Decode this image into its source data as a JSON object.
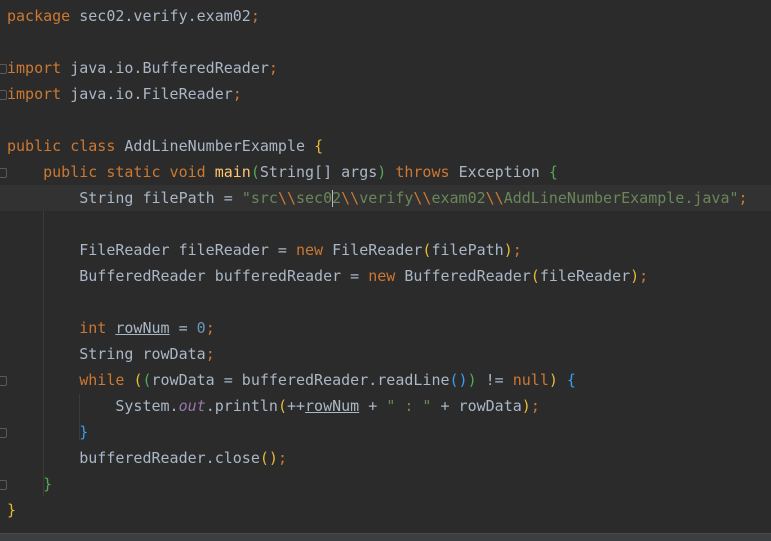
{
  "editor": {
    "lines": [
      [
        {
          "t": "package",
          "c": "kw"
        },
        {
          "t": " sec02.verify.exam02",
          "c": "plain"
        },
        {
          "t": ";",
          "c": "kw"
        }
      ],
      [],
      [
        {
          "t": "import",
          "c": "kw"
        },
        {
          "t": " java.io.BufferedReader",
          "c": "plain"
        },
        {
          "t": ";",
          "c": "kw"
        }
      ],
      [
        {
          "t": "import",
          "c": "kw"
        },
        {
          "t": " java.io.FileReader",
          "c": "plain"
        },
        {
          "t": ";",
          "c": "kw"
        }
      ],
      [],
      [
        {
          "t": "public class ",
          "c": "kw"
        },
        {
          "t": "AddLineNumberExample ",
          "c": "plain"
        },
        {
          "t": "{",
          "c": "p1"
        }
      ],
      [
        {
          "t": "    ",
          "c": "plain"
        },
        {
          "t": "public static void ",
          "c": "kw"
        },
        {
          "t": "main",
          "c": "fn"
        },
        {
          "t": "(",
          "c": "p2"
        },
        {
          "t": "String[] args",
          "c": "plain"
        },
        {
          "t": ")",
          "c": "p2"
        },
        {
          "t": " throws ",
          "c": "kw"
        },
        {
          "t": "Exception ",
          "c": "plain"
        },
        {
          "t": "{",
          "c": "p2"
        }
      ],
      [
        {
          "t": "        String filePath = ",
          "c": "plain"
        },
        {
          "t": "\"src",
          "c": "str"
        },
        {
          "t": "\\\\",
          "c": "esc"
        },
        {
          "t": "sec02",
          "c": "str"
        },
        {
          "t": "\\\\",
          "c": "esc"
        },
        {
          "t": "verify",
          "c": "str"
        },
        {
          "t": "\\\\",
          "c": "esc"
        },
        {
          "t": "exam02",
          "c": "str"
        },
        {
          "t": "\\\\",
          "c": "esc"
        },
        {
          "t": "AddLineNumberExample.java\"",
          "c": "str"
        },
        {
          "t": ";",
          "c": "kw"
        }
      ],
      [],
      [
        {
          "t": "        FileReader fileReader = ",
          "c": "plain"
        },
        {
          "t": "new ",
          "c": "kw"
        },
        {
          "t": "FileReader",
          "c": "plain"
        },
        {
          "t": "(",
          "c": "p1"
        },
        {
          "t": "filePath",
          "c": "plain"
        },
        {
          "t": ")",
          "c": "p1"
        },
        {
          "t": ";",
          "c": "kw"
        }
      ],
      [
        {
          "t": "        BufferedReader bufferedReader = ",
          "c": "plain"
        },
        {
          "t": "new ",
          "c": "kw"
        },
        {
          "t": "BufferedReader",
          "c": "plain"
        },
        {
          "t": "(",
          "c": "p1"
        },
        {
          "t": "fileReader",
          "c": "plain"
        },
        {
          "t": ")",
          "c": "p1"
        },
        {
          "t": ";",
          "c": "kw"
        }
      ],
      [],
      [
        {
          "t": "        ",
          "c": "plain"
        },
        {
          "t": "int ",
          "c": "kw"
        },
        {
          "t": "rowNum",
          "c": "plain ul"
        },
        {
          "t": " = ",
          "c": "plain"
        },
        {
          "t": "0",
          "c": "num"
        },
        {
          "t": ";",
          "c": "kw"
        }
      ],
      [
        {
          "t": "        String rowData",
          "c": "plain"
        },
        {
          "t": ";",
          "c": "kw"
        }
      ],
      [
        {
          "t": "        ",
          "c": "plain"
        },
        {
          "t": "while ",
          "c": "kw"
        },
        {
          "t": "(",
          "c": "p1"
        },
        {
          "t": "(",
          "c": "p2"
        },
        {
          "t": "rowData = bufferedReader.readLine",
          "c": "plain"
        },
        {
          "t": "()",
          "c": "p3"
        },
        {
          "t": ")",
          "c": "p2"
        },
        {
          "t": " != ",
          "c": "plain"
        },
        {
          "t": "null",
          "c": "kw"
        },
        {
          "t": ")",
          "c": "p1"
        },
        {
          "t": " ",
          "c": "plain"
        },
        {
          "t": "{",
          "c": "p3"
        }
      ],
      [
        {
          "t": "            System.",
          "c": "plain"
        },
        {
          "t": "out",
          "c": "static-field"
        },
        {
          "t": ".println",
          "c": "plain"
        },
        {
          "t": "(",
          "c": "p1"
        },
        {
          "t": "++",
          "c": "plain"
        },
        {
          "t": "rowNum",
          "c": "plain ul"
        },
        {
          "t": " + ",
          "c": "plain"
        },
        {
          "t": "\" : \"",
          "c": "str"
        },
        {
          "t": " + rowData",
          "c": "plain"
        },
        {
          "t": ")",
          "c": "p1"
        },
        {
          "t": ";",
          "c": "kw"
        }
      ],
      [
        {
          "t": "        ",
          "c": "plain"
        },
        {
          "t": "}",
          "c": "p3"
        }
      ],
      [
        {
          "t": "        bufferedReader.close",
          "c": "plain"
        },
        {
          "t": "()",
          "c": "p1"
        },
        {
          "t": ";",
          "c": "kw"
        }
      ],
      [
        {
          "t": "    ",
          "c": "plain"
        },
        {
          "t": "}",
          "c": "p2"
        }
      ],
      [
        {
          "t": "}",
          "c": "p1"
        }
      ]
    ],
    "current_line": 7,
    "caret_after_chars": 36,
    "fold_marker_lines": [
      2,
      3,
      6,
      14,
      16,
      18
    ]
  }
}
